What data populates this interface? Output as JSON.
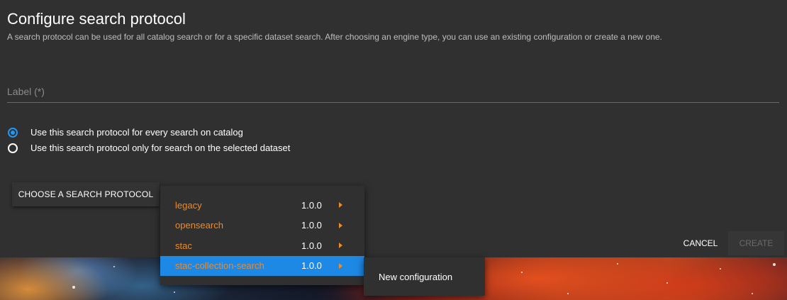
{
  "dialog": {
    "title": "Configure search protocol",
    "subtitle": "A search protocol can be used for all catalog search or for a specific dataset search. After choosing an engine type, you can use an existing configuration or create a new one."
  },
  "label_field": {
    "placeholder": "Label (*)",
    "value": ""
  },
  "scope_options": [
    {
      "label": "Use this search protocol for every search on catalog",
      "checked": true
    },
    {
      "label": "Use this search protocol only for search on the selected dataset",
      "checked": false
    }
  ],
  "choose_button": {
    "label": "CHOOSE A SEARCH PROTOCOL"
  },
  "protocol_menu": {
    "items": [
      {
        "name": "legacy",
        "version": "1.0.0",
        "selected": false,
        "icon": "chevron-right-icon"
      },
      {
        "name": "opensearch",
        "version": "1.0.0",
        "selected": false,
        "icon": "chevron-right-icon"
      },
      {
        "name": "stac",
        "version": "1.0.0",
        "selected": false,
        "icon": "chevron-right-icon"
      },
      {
        "name": "stac-collection-search",
        "version": "1.0.0",
        "selected": true,
        "icon": "chevron-right-icon"
      }
    ]
  },
  "sub_menu": {
    "items": [
      {
        "label": "New configuration"
      }
    ]
  },
  "actions": {
    "cancel_label": "CANCEL",
    "create_label": "CREATE",
    "create_enabled": false
  },
  "colors": {
    "background": "#303030",
    "accent_blue": "#1e88e5",
    "protocol_orange": "#f08a24",
    "disabled_text": "#6a6a6a"
  }
}
